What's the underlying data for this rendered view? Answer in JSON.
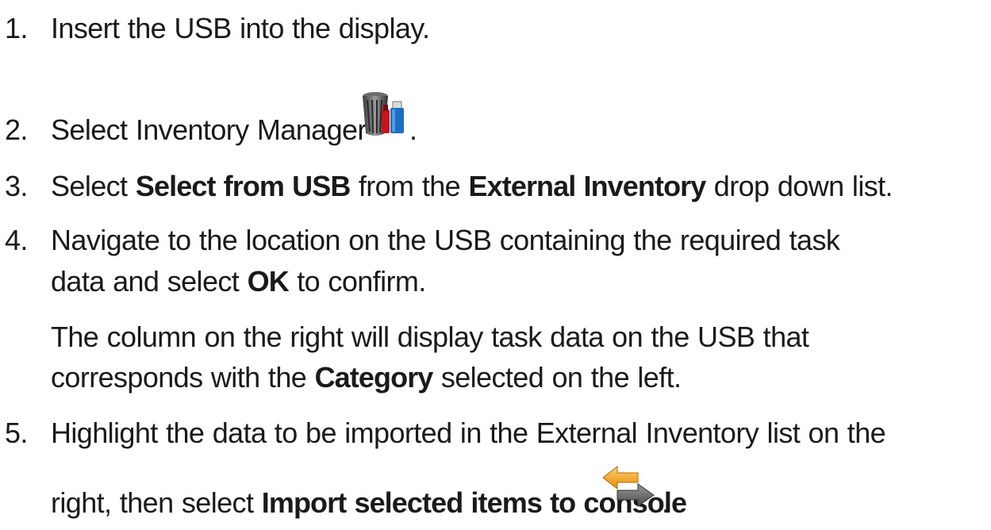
{
  "steps": [
    {
      "num": "1.",
      "text": "Insert the USB into the display."
    },
    {
      "num": "2.",
      "text": "Select Inventory Manager",
      "after": ".",
      "icon": "inventory-manager-icon"
    },
    {
      "num": "3.",
      "pre": "Select ",
      "b1": "Select from USB",
      "mid": " from the ",
      "b2": "External Inventory",
      "post": " drop down list."
    },
    {
      "num": "4.",
      "l1": "Navigate to the location on the USB containing the required task",
      "l2_pre": "data and select ",
      "l2_b": "OK",
      "l2_post": " to confirm."
    },
    {
      "note_l1": "The column on the right will display task data on the USB that",
      "note_l2_pre": "corresponds with the ",
      "note_l2_b": "Category",
      "note_l2_post": " selected on the left."
    },
    {
      "num": "5.",
      "l1": "Highlight the data to be imported in the External Inventory list on the",
      "l2_pre": "right, then select ",
      "l2_b": "Import selected items to console",
      "after": ".",
      "icon": "import-arrows-icon"
    }
  ]
}
